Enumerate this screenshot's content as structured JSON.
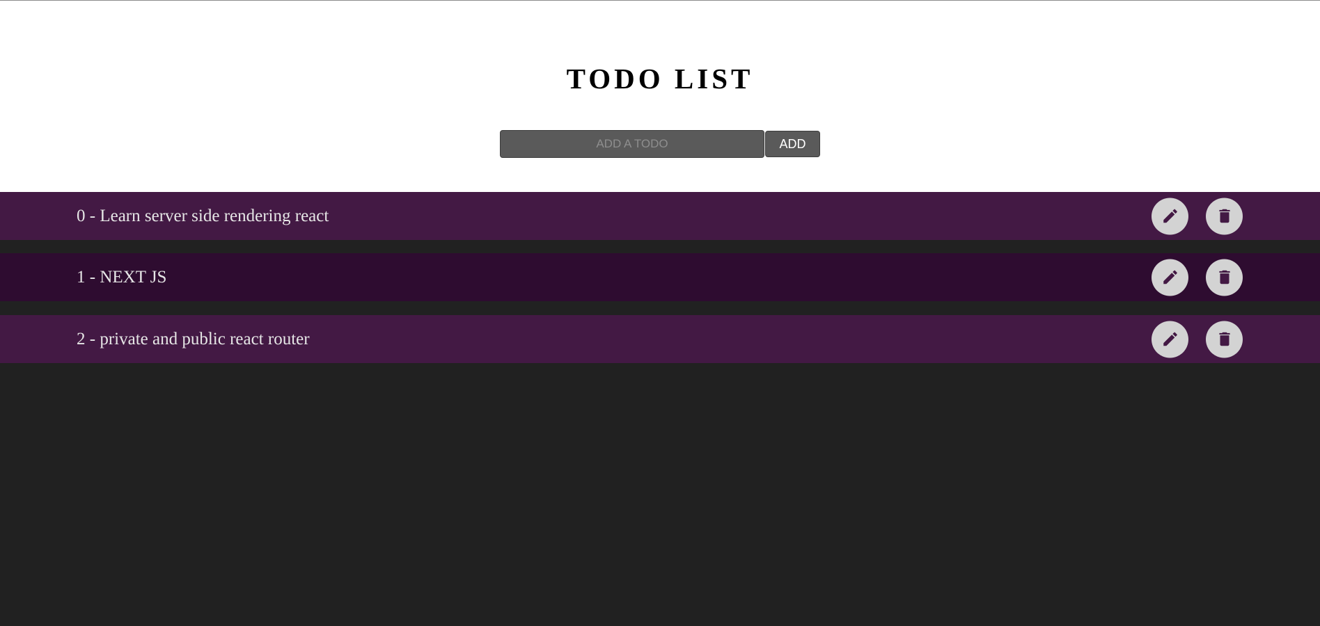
{
  "app": {
    "title": "TODO LIST"
  },
  "add_form": {
    "input_value": "",
    "input_placeholder": "ADD A TODO",
    "add_label": "ADD"
  },
  "todos": [
    {
      "text": "0 - Learn server side rendering react"
    },
    {
      "text": "1 - NEXT JS"
    },
    {
      "text": "2 - private and public react router"
    }
  ],
  "icons": {
    "edit": "pencil-icon",
    "delete": "trash-icon"
  },
  "colors": {
    "page_background": "#212121",
    "header_background": "#ffffff",
    "row_background": "#431944",
    "row_background_alt": "#2e0c30",
    "control_background": "#5a5a5a",
    "icon_button_background": "#d3d3d3",
    "icon_color": "#431944",
    "todo_text": "#e6e6e6"
  }
}
